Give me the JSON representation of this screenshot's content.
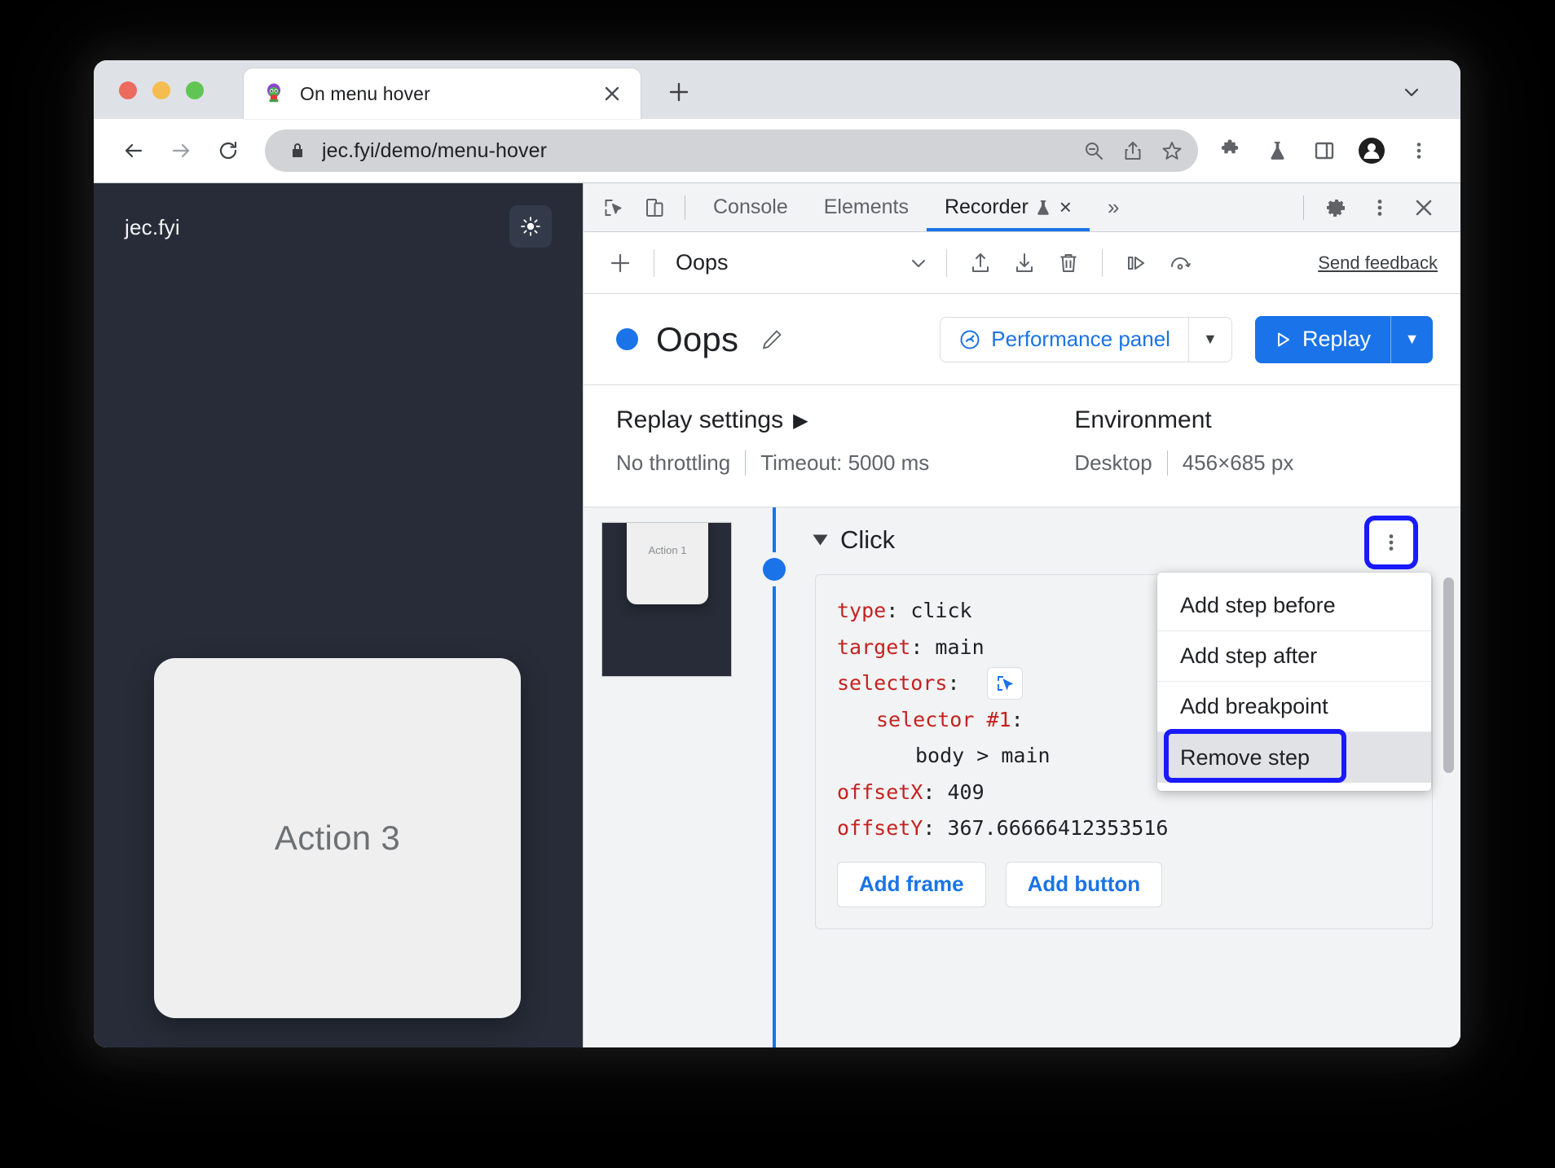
{
  "browser": {
    "tab": {
      "title": "On menu hover",
      "favicon": "extension-puzzle-avatar-icon",
      "close_label": "×"
    },
    "new_tab_label": "+",
    "tabstrip_chevron": "chevron-down-icon",
    "nav": {
      "back": "back-arrow-icon",
      "forward": "forward-arrow-icon",
      "reload": "reload-icon"
    },
    "omnibox": {
      "url": "jec.fyi/demo/menu-hover",
      "lock": "lock-icon",
      "zoom_out": "zoom-out-icon",
      "share": "share-icon",
      "bookmark": "star-icon"
    },
    "toolbar_icons": [
      "extensions-puzzle-icon",
      "flask-icon",
      "side-panel-icon",
      "profile-avatar-icon",
      "kebab-menu-icon"
    ]
  },
  "page": {
    "brand": "jec.fyi",
    "theme_toggle": "sun-icon",
    "card_label": "Action 3"
  },
  "devtools": {
    "tools": {
      "inspect": "inspect-cursor-icon",
      "device_toolbar": "device-toolbar-icon"
    },
    "tabs": [
      {
        "label": "Console",
        "active": false
      },
      {
        "label": "Elements",
        "active": false
      },
      {
        "label": "Recorder",
        "active": true,
        "badge": "flask-icon",
        "close": "×"
      }
    ],
    "more_tabs": "»",
    "header_icons": [
      "gear-icon",
      "kebab-menu-icon",
      "close-icon"
    ]
  },
  "recorder": {
    "toolbar": {
      "add": "+",
      "selected_recording": "Oops",
      "select_chevron": "chevron-down-icon",
      "import": "import-upload-icon",
      "export": "export-download-icon",
      "delete": "trash-icon",
      "step_over": "step-over-icon",
      "replay_speed": "replay-speed-icon",
      "feedback_label": "Send feedback"
    },
    "title": {
      "name": "Oops",
      "status_dot_color": "#1a73e8",
      "edit": "pencil-icon",
      "performance_label": "Performance panel",
      "performance_icon": "performance-gauge-icon",
      "performance_arrow": "▼",
      "replay_label": "Replay",
      "replay_icon": "play-triangle-icon",
      "replay_arrow": "▼"
    },
    "settings": {
      "replay_heading": "Replay settings",
      "replay_heading_arrow": "▶",
      "throttling": "No throttling",
      "timeout": "Timeout: 5000 ms",
      "environment_heading": "Environment",
      "device": "Desktop",
      "viewport": "456×685 px"
    },
    "timeline": {
      "thumbnail_label": "Action 1",
      "node": "step-node-dot"
    },
    "step": {
      "caret": "caret-expanded-icon",
      "title": "Click",
      "kebab": "kebab-menu-icon",
      "code": [
        {
          "indent": 0,
          "key": "type",
          "value": "click"
        },
        {
          "indent": 0,
          "key": "target",
          "value": "main"
        },
        {
          "indent": 0,
          "key": "selectors",
          "value": "",
          "picker": "selector-picker-icon"
        },
        {
          "indent": 1,
          "key": "selector #1",
          "value": ""
        },
        {
          "indent": 2,
          "key": "",
          "value": "body > main"
        },
        {
          "indent": 0,
          "key": "offsetX",
          "value": "409"
        },
        {
          "indent": 0,
          "key": "offsetY",
          "value": "367.66666412353516"
        }
      ],
      "buttons": [
        "Add frame",
        "Add button"
      ]
    },
    "context_menu": {
      "items": [
        {
          "label": "Add step before",
          "selected": false
        },
        {
          "label": "Add step after",
          "selected": false
        },
        {
          "label": "Add breakpoint",
          "selected": false
        },
        {
          "label": "Remove step",
          "selected": true
        }
      ],
      "highlight_color": "#1a1aff"
    }
  }
}
